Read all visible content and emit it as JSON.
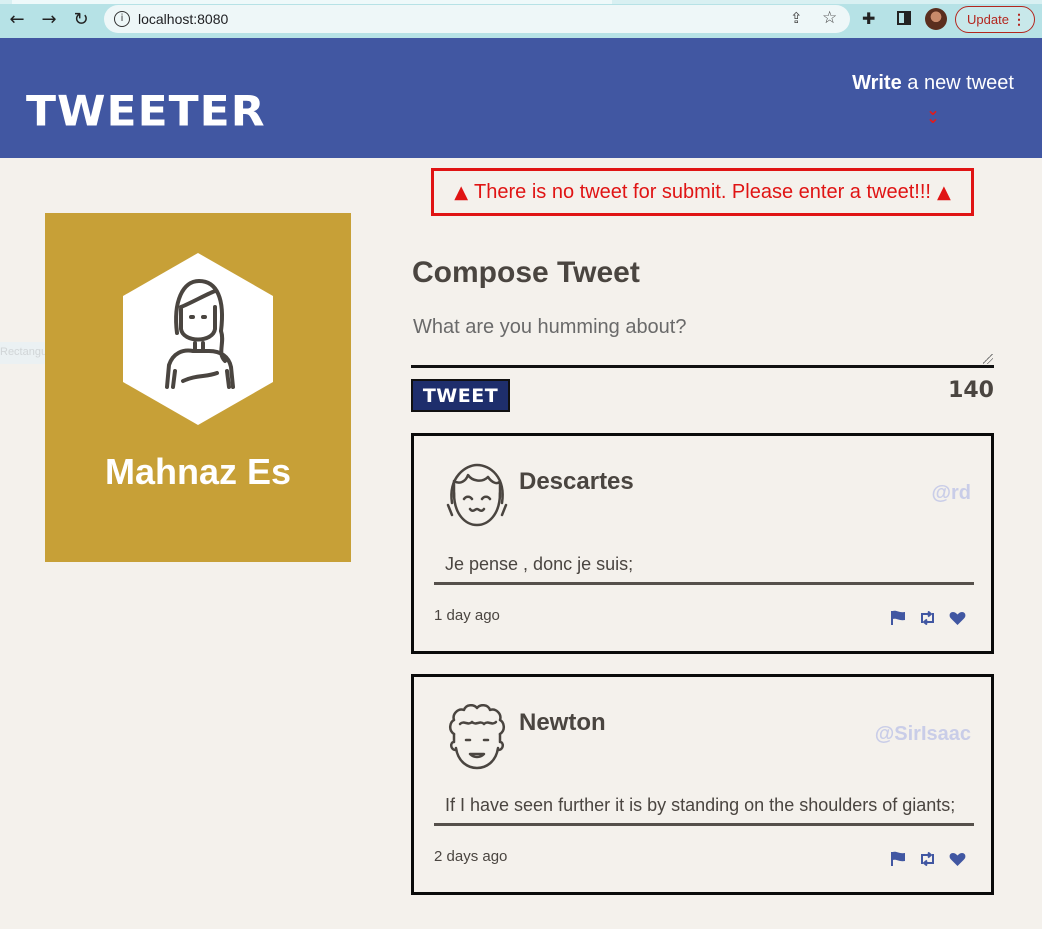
{
  "browser": {
    "url": "localhost:8080",
    "update_label": "Update"
  },
  "header": {
    "logo": "TWEETER",
    "write_bold": "Write",
    "write_rest": " a new tweet"
  },
  "error": {
    "message": "There is no tweet for submit. Please enter a tweet!!!"
  },
  "snip_ghost": "Rectangular Snip",
  "profile": {
    "name": "Mahnaz Es",
    "card_color": "#c7a037"
  },
  "compose": {
    "title": "Compose Tweet",
    "placeholder": "What are you humming about?",
    "button_label": "TWEET",
    "counter": "140"
  },
  "tweets": [
    {
      "name": "Descartes",
      "handle": "@rd",
      "text": "Je pense , donc je suis;",
      "time": "1 day ago"
    },
    {
      "name": "Newton",
      "handle": "@SirIsaac",
      "text": "If I have seen further it is by standing on the shoulders of giants;",
      "time": "2 days ago"
    }
  ],
  "colors": {
    "header_bg": "#4157a2",
    "error": "#e01414",
    "action_icons": "#4157a2"
  }
}
